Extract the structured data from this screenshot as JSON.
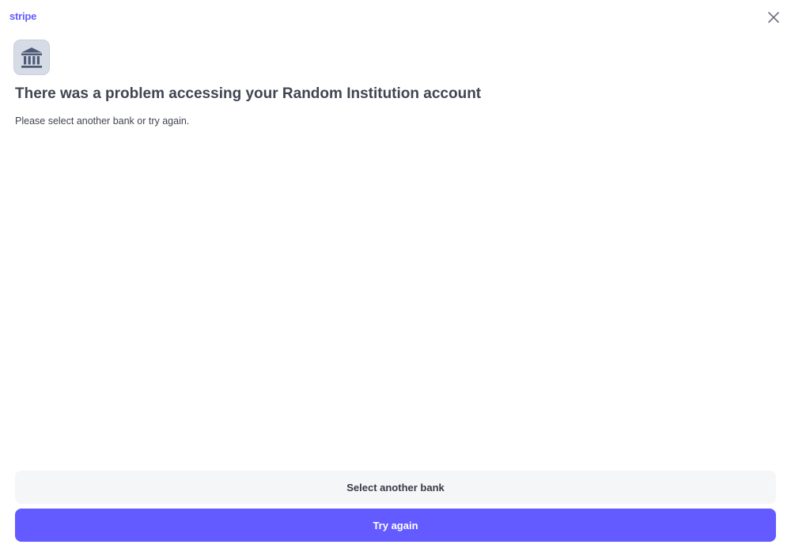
{
  "header": {
    "brand_name": "stripe",
    "close_icon": "close-icon"
  },
  "error": {
    "icon": "bank-icon",
    "title": "There was a problem accessing your Random Institution account",
    "message": "Please select another bank or try again."
  },
  "actions": {
    "select_another_bank_label": "Select another bank",
    "try_again_label": "Try again"
  },
  "colors": {
    "brand": "#635bff",
    "primary_button": "#635bff",
    "secondary_button": "#f5f6f8",
    "icon_tile": "#d5dce6",
    "icon_fill": "#4f5b76",
    "text": "#414552"
  }
}
